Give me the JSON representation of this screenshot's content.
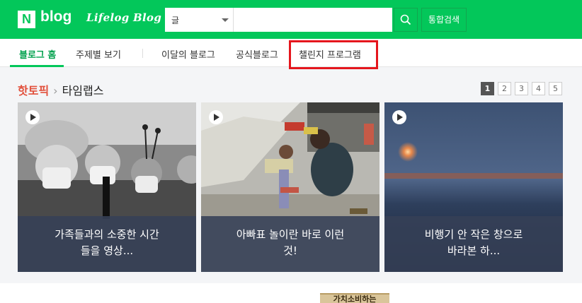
{
  "header": {
    "logo_n": "N",
    "logo_blog": "blog",
    "logo_lifelog": "Lifelog Blog",
    "search_scope": "글",
    "search_value": "",
    "search_placeholder": "",
    "total_search_label": "통합검색",
    "brand_color": "#03c75a"
  },
  "nav": {
    "items": [
      {
        "label": "블로그 홈",
        "active": true
      },
      {
        "label": "주제별 보기"
      },
      {
        "label": "이달의 블로그"
      },
      {
        "label": "공식블로그"
      },
      {
        "label": "챌린지 프로그램",
        "highlighted": true
      }
    ],
    "highlight_color": "#e5161d"
  },
  "section": {
    "title": "핫토픽",
    "subtitle": "타임랩스",
    "pages": [
      "1",
      "2",
      "3",
      "4",
      "5"
    ],
    "current_page": "1"
  },
  "cards": [
    {
      "caption_line1": "가족들과의 소중한 시간",
      "caption_line2": "들을 영상...",
      "icon": "play-icon"
    },
    {
      "caption_line1": "아빠표 놀이란 바로 이런",
      "caption_line2": "것!",
      "icon": "play-icon"
    },
    {
      "caption_line1": "비행기 안 작은 창으로",
      "caption_line2": "바라본 하...",
      "icon": "play-icon"
    }
  ],
  "promo": {
    "text": "가치소비하는"
  }
}
